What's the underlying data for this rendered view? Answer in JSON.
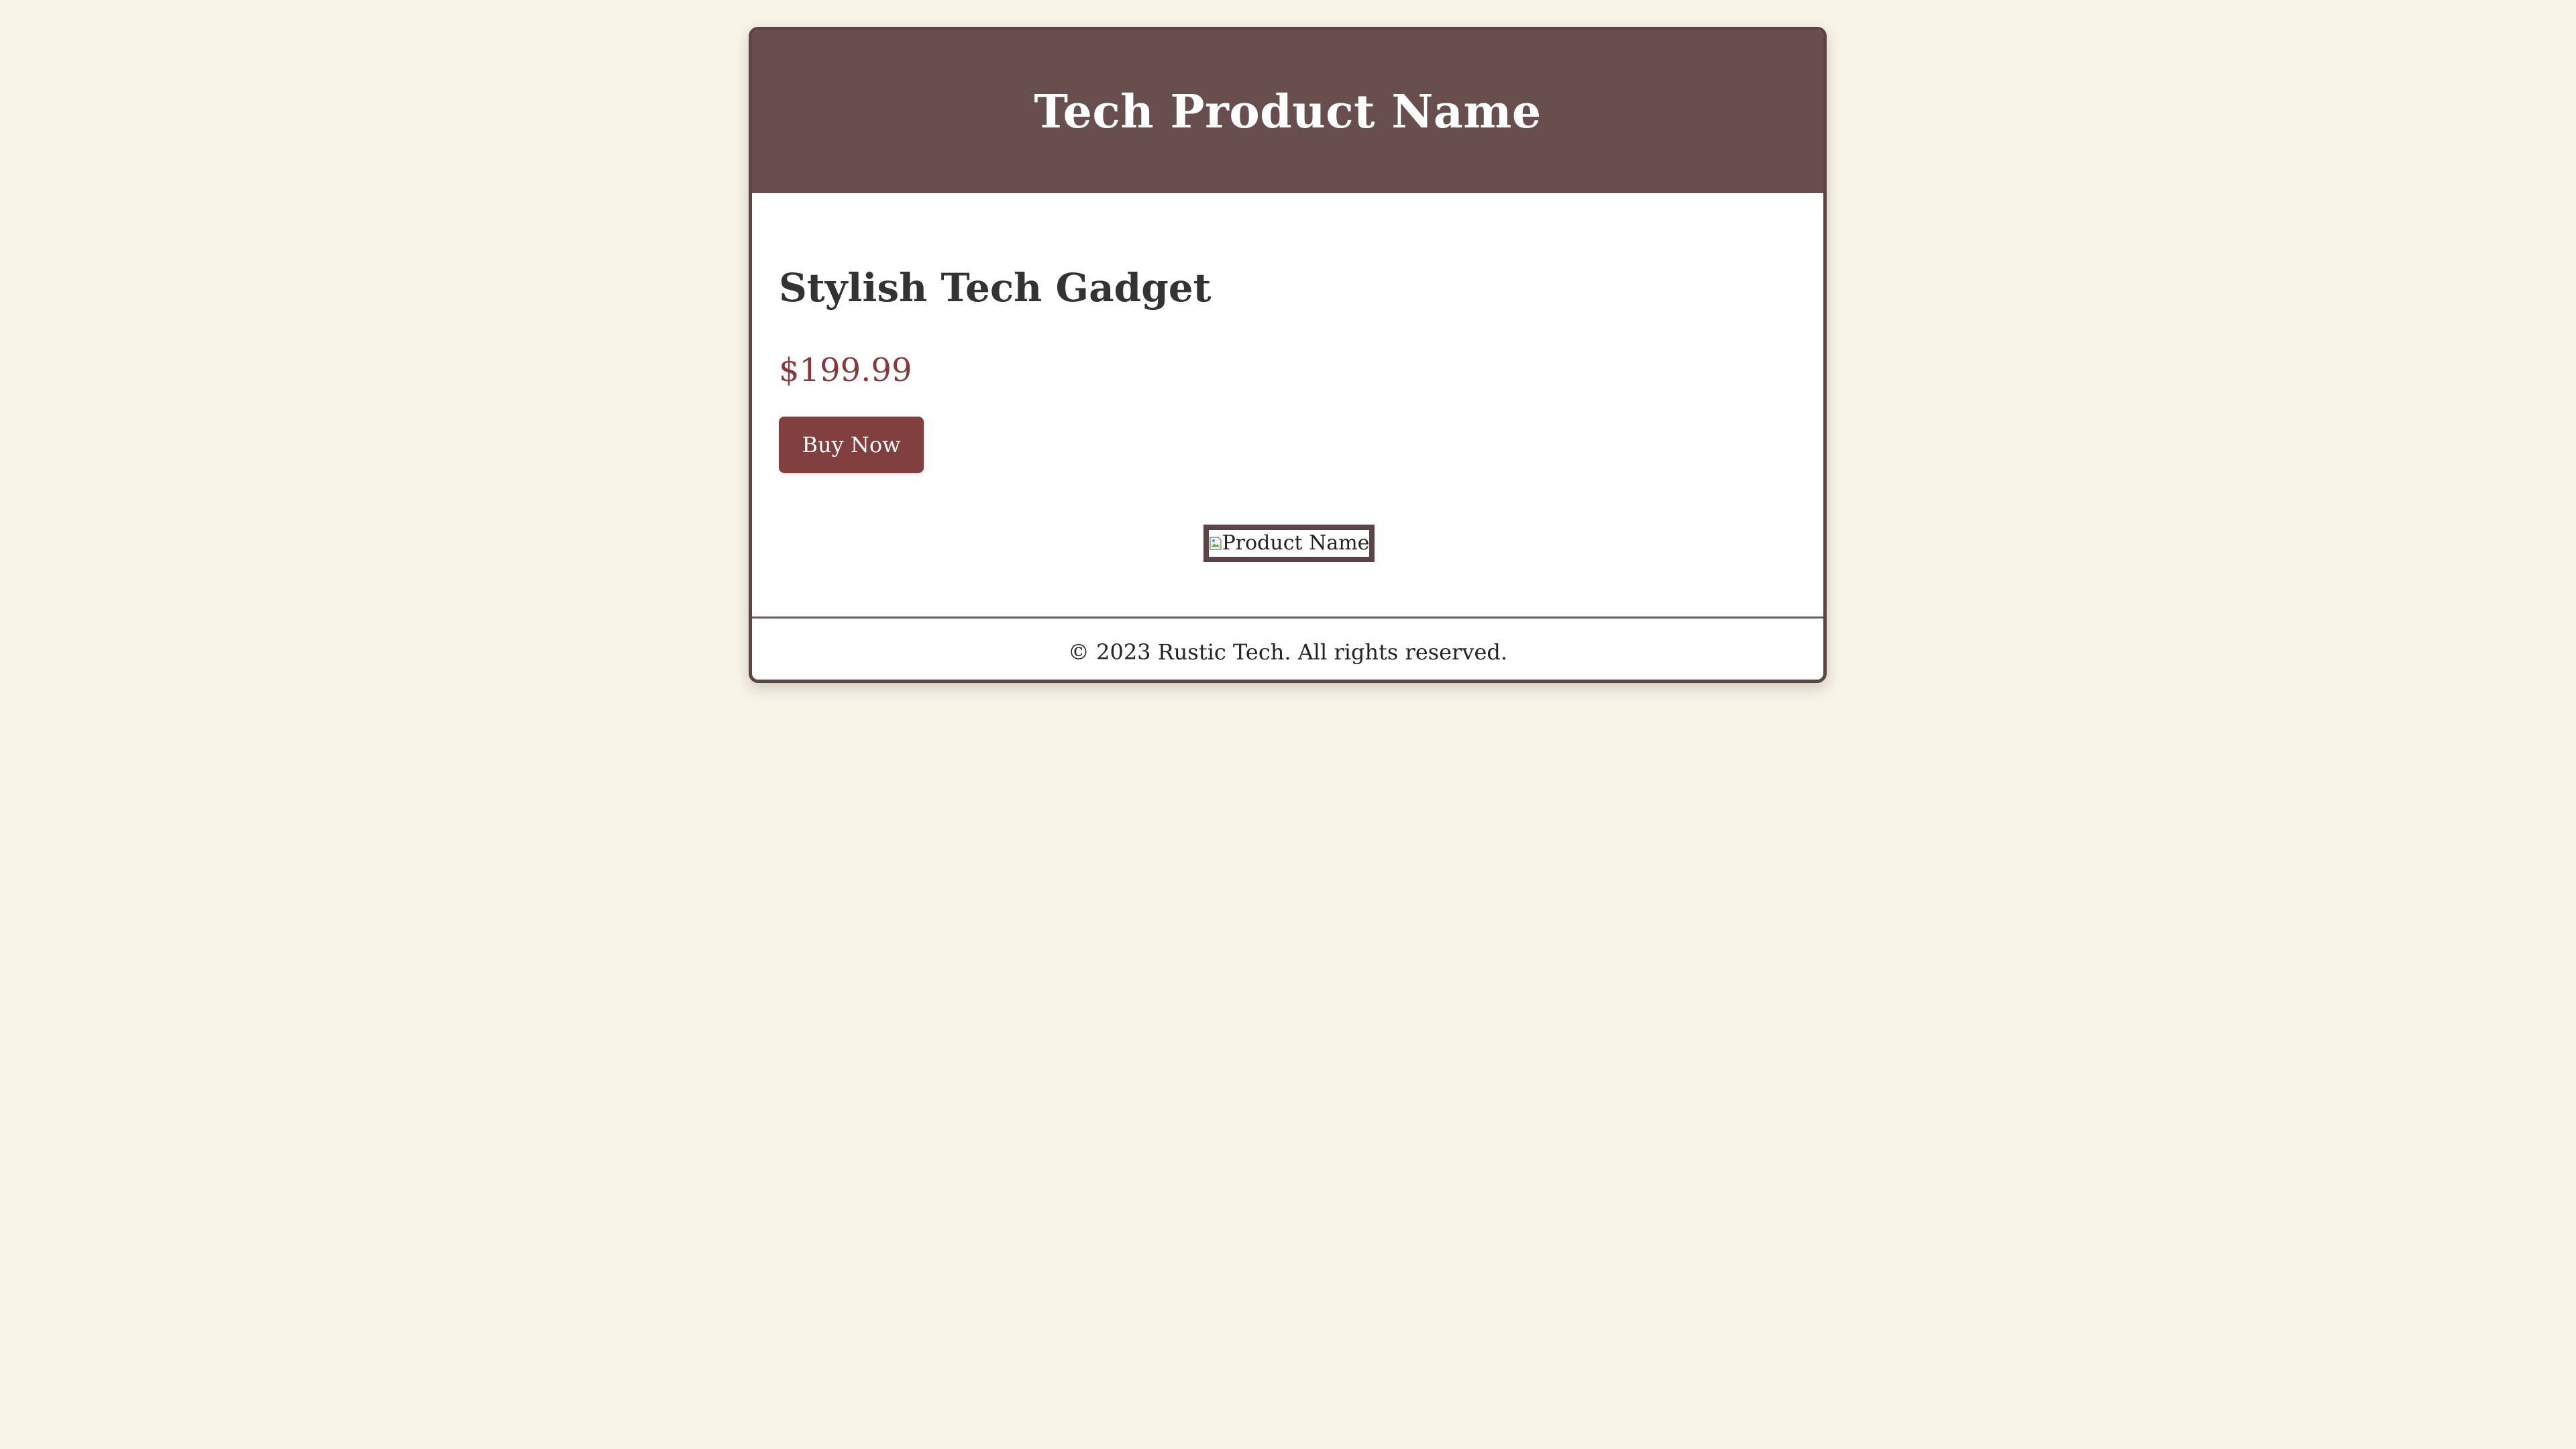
{
  "header": {
    "title": "Tech Product Name"
  },
  "product": {
    "heading": "Stylish Tech Gadget",
    "price": "$199.99",
    "buy_label": "Buy Now",
    "image_alt": "Product Name",
    "image_icon": "broken-image-icon"
  },
  "footer": {
    "copyright": "© 2023 Rustic Tech. All rights reserved."
  },
  "colors": {
    "page_background": "#f8f4e8",
    "header_background": "#694e4e",
    "price_text": "#86393d",
    "button_background": "#823f40",
    "border": "#5b4445"
  }
}
